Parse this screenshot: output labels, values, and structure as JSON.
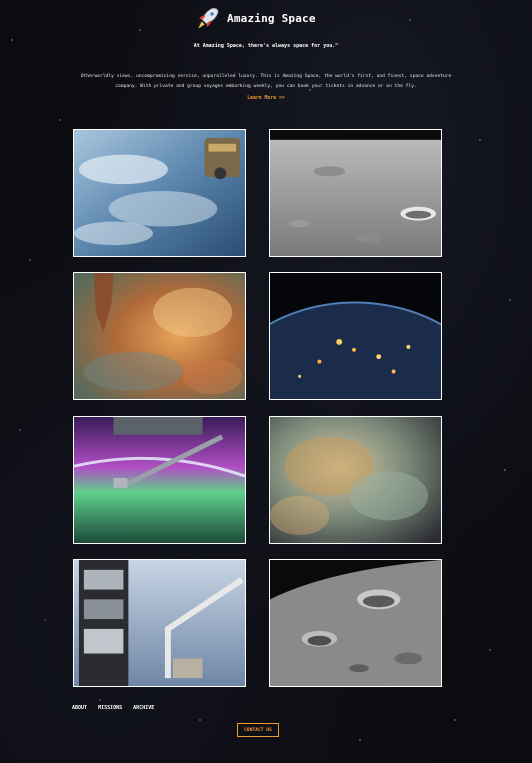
{
  "header": {
    "title": "Amazing Space",
    "tagline": "At Amazing Space, there's always space for you.™",
    "intro": "Otherworldly views, uncompromising service, unparalleled luxury. This is Amazing Space, the world's first, and finest, space adventure company. With private and group voyages embarking weekly, you can book your tickets in advance or on the fly.",
    "learn_more": "Learn More >>",
    "logo_icon": "rocket-icon"
  },
  "gallery": {
    "images": [
      {
        "name": "earth-orbit-station-photo"
      },
      {
        "name": "moon-surface-photo"
      },
      {
        "name": "nebula-pillar-photo"
      },
      {
        "name": "earth-night-lights-photo"
      },
      {
        "name": "aurora-robotic-arm-photo"
      },
      {
        "name": "cosmic-cloud-photo"
      },
      {
        "name": "hubble-telescope-photo"
      },
      {
        "name": "moon-craters-photo"
      }
    ]
  },
  "footer": {
    "nav": [
      "ABOUT",
      "MISSIONS",
      "ARCHIVE"
    ],
    "contact_label": "CONTACT US"
  },
  "colors": {
    "background": "#0b0c10",
    "accent": "#f29a2e",
    "text": "#ffffff"
  }
}
